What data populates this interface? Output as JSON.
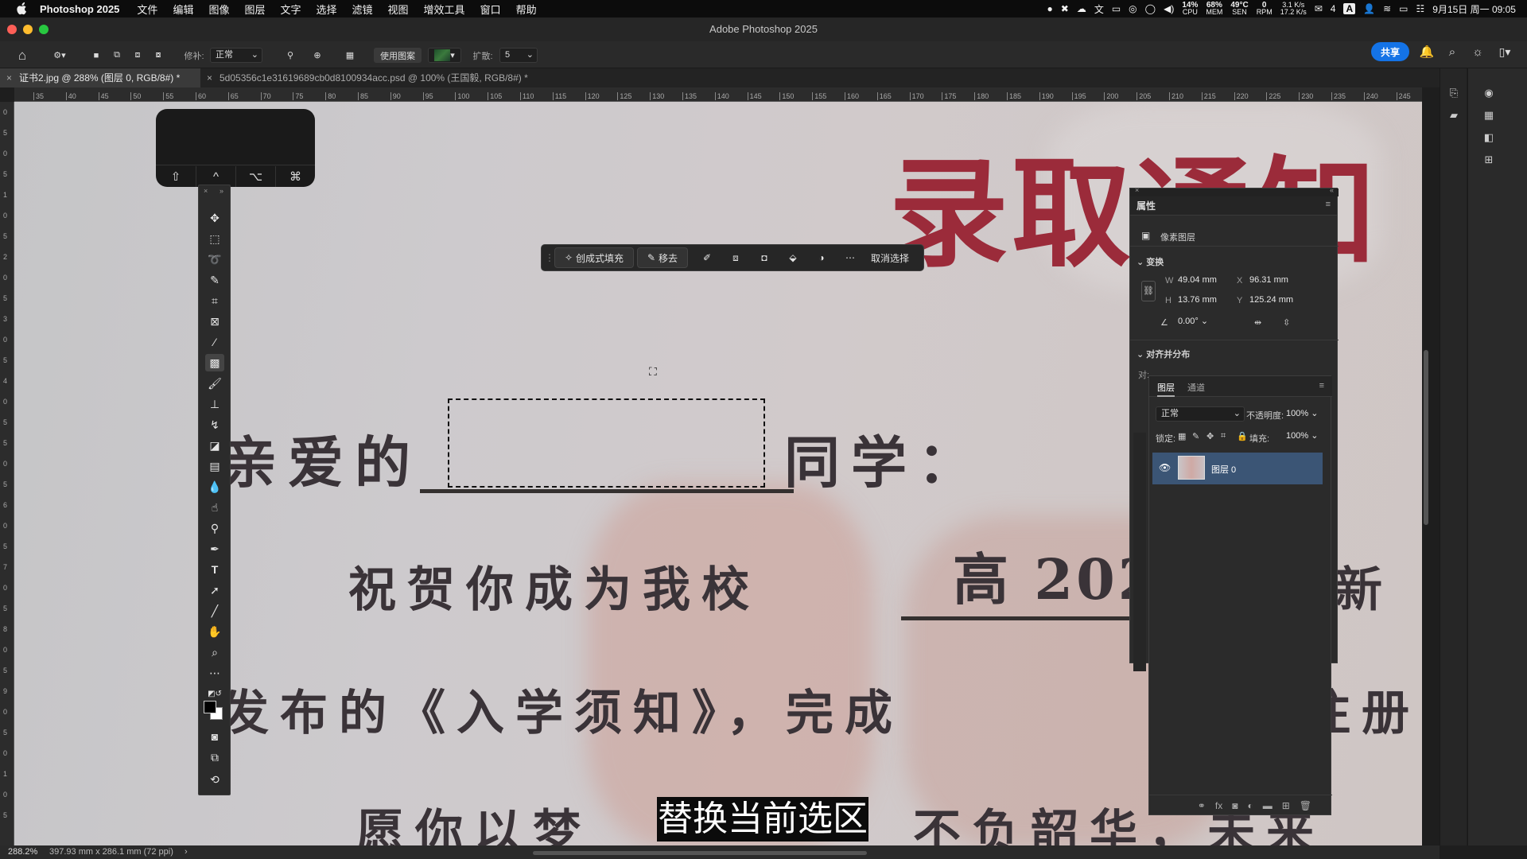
{
  "menubar": {
    "app_name": "Photoshop 2025",
    "menus": [
      "文件",
      "编辑",
      "图像",
      "图层",
      "文字",
      "选择",
      "滤镜",
      "视图",
      "增效工具",
      "窗口",
      "帮助"
    ],
    "status": {
      "cpu": "14%",
      "cpu_label": "CPU",
      "mem": "68%",
      "mem_label": "MEM",
      "sen": "49°C",
      "sen_label": "SEN",
      "rpm": "0",
      "rpm_label": "RPM",
      "net_up": "3.1 K/s",
      "net_down": "17.2 K/s",
      "wechat_count": "4",
      "input_method": "A",
      "datetime": "9月15日 周一 09:05"
    }
  },
  "window": {
    "title": "Adobe Photoshop 2025"
  },
  "options": {
    "feather_label": "修补:",
    "mode": "正常",
    "use_pattern": "使用图案",
    "expand_label": "扩散:",
    "expand_value": "5",
    "share": "共享"
  },
  "tabs": [
    {
      "label": "证书2.jpg @ 288% (图层 0, RGB/8#) *",
      "active": true
    },
    {
      "label": "5d05356c1e31619689cb0d8100934acc.psd @ 100% (王国毅, RGB/8#) *",
      "active": false
    }
  ],
  "ruler": {
    "top": [
      "35",
      "40",
      "45",
      "50",
      "55",
      "60",
      "65",
      "70",
      "75",
      "80",
      "85",
      "90",
      "95",
      "100",
      "105",
      "110",
      "115",
      "120",
      "125",
      "130",
      "135",
      "140",
      "145",
      "150",
      "155",
      "160",
      "165",
      "170",
      "175",
      "180",
      "185",
      "190",
      "195",
      "200",
      "205",
      "210",
      "215",
      "220",
      "225",
      "230",
      "235",
      "240",
      "245"
    ],
    "left": [
      "0",
      "5",
      "0",
      "5",
      "1",
      "0",
      "5",
      "2",
      "0",
      "5",
      "3",
      "0",
      "5",
      "4",
      "0",
      "5",
      "5",
      "0",
      "5",
      "6",
      "0",
      "5",
      "7",
      "0",
      "5",
      "8",
      "0",
      "5",
      "9",
      "0",
      "5",
      "0",
      "1",
      "0",
      "5"
    ]
  },
  "document": {
    "heading": "录取通知",
    "line1_left": "亲爱的",
    "line1_right": "同学：",
    "line2": "祝贺你成为我校",
    "line2_fill": "高 202",
    "line2_end": "新",
    "line3_left": "发布的《入学须知》，完成",
    "line3_end": "注册",
    "line4_left": "愿你以梦",
    "line4_right": "不负韶华，未来"
  },
  "touchbar": {
    "keys": [
      "⇧",
      "^",
      "⌥",
      "⌘"
    ]
  },
  "contextbar": {
    "gen_fill": "创成式填充",
    "remove": "移去",
    "deselect": "取消选择"
  },
  "properties": {
    "title": "属性",
    "kind": "像素图层",
    "transform": "变换",
    "w_label": "W",
    "w": "49.04 mm",
    "x_label": "X",
    "x": "96.31 mm",
    "h_label": "H",
    "h": "13.76 mm",
    "y_label": "Y",
    "y": "125.24 mm",
    "angle": "0.00°",
    "align": "对齐并分布",
    "align_short": "对:"
  },
  "layers": {
    "tab_layers": "图层",
    "tab_channels": "通道",
    "blend": "正常",
    "opacity_label": "不透明度:",
    "opacity": "100%",
    "lock_label": "锁定:",
    "fill_label": "填充:",
    "fill": "100%",
    "layer_name": "图层 0"
  },
  "subtitle": "替换当前选区",
  "statusbar": {
    "zoom": "288.2%",
    "doc_size": "397.93 mm x 286.1 mm (72 ppi)"
  },
  "colors": {
    "accent": "#1473e6",
    "selected_layer": "#3b5575",
    "seal_red": "#9b2b3a"
  }
}
